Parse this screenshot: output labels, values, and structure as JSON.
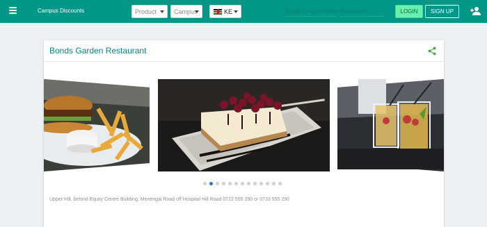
{
  "header": {
    "brand": "Campus Discounts",
    "filters": {
      "product": "Product",
      "campus": "Campus",
      "country": "KE"
    },
    "login": {
      "email_placeholder": "Email or Username",
      "password_placeholder": "Password",
      "login_label": "LOGIN",
      "signup_label": "SIGN UP"
    },
    "icons": {
      "menu": "menu-icon",
      "flag": "kenya-flag-icon",
      "add_user": "add-user-icon"
    }
  },
  "card": {
    "title": "Bonds Garden Restaurant",
    "share_icon": "share-icon",
    "carousel": {
      "slides": [
        "burger-and-fries",
        "cheesecake-dessert",
        "cocktail-drinks"
      ],
      "dot_count": 13,
      "active_index": 1
    },
    "address": "Upper Hill, behind Equity Centre Building, Menengai Road off Hospital Hill Road 0722 555 290 or 0733 555 290"
  },
  "colors": {
    "topbar": "#009688",
    "title": "#00897b",
    "login_button": "#69f0ae",
    "active_dot": "#2f6fd6"
  }
}
